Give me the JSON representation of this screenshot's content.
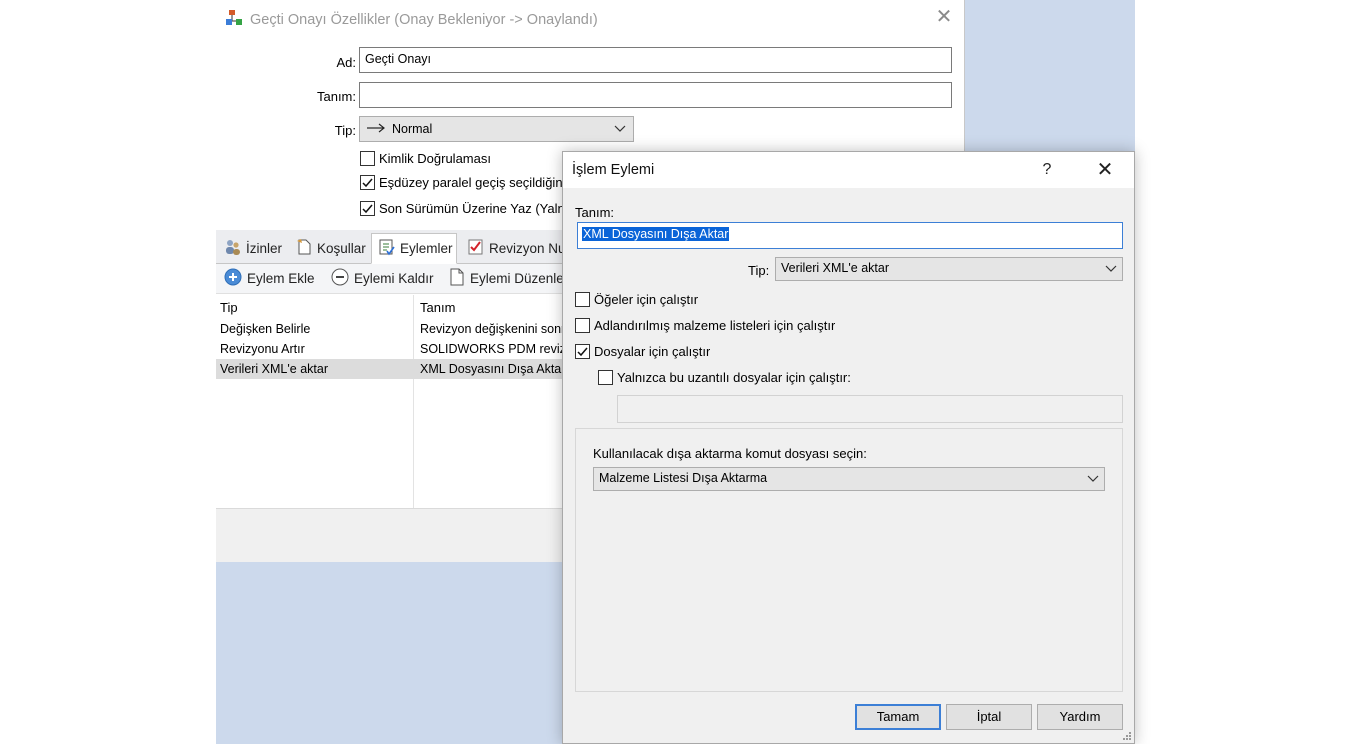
{
  "main_window": {
    "title": "Geçti Onayı Özellikler (Onay Bekleniyor -> Onaylandı)",
    "name_label": "Ad:",
    "name_value": "Geçti Onayı",
    "desc_label": "Tanım:",
    "desc_value": "",
    "type_label": "Tip:",
    "type_value": "Normal",
    "checkboxes": [
      {
        "label": "Kimlik Doğrulaması",
        "checked": false
      },
      {
        "label": "Eşdüzey paralel geçiş seçildiğinde",
        "checked": true
      },
      {
        "label": "Son Sürümün Üzerine Yaz (Yalnızca",
        "checked": true
      }
    ],
    "tabs": [
      {
        "label": "İzinler",
        "icon": "users-icon"
      },
      {
        "label": "Koşullar",
        "icon": "document-hand-icon"
      },
      {
        "label": "Eylemler",
        "icon": "checklist-icon",
        "active": true
      },
      {
        "label": "Revizyon Nu",
        "icon": "red-check-icon"
      }
    ],
    "toolbar": {
      "add": "Eylem Ekle",
      "remove": "Eylemi Kaldır",
      "edit": "Eylemi Düzenle"
    },
    "grid": {
      "headers": [
        "Tip",
        "Tanım"
      ],
      "rows": [
        {
          "type": "Değişken Belirle",
          "desc": "Revizyon değişkenini sonr",
          "selected": false
        },
        {
          "type": "Revizyonu Artır",
          "desc": "SOLIDWORKS PDM revizy",
          "selected": false
        },
        {
          "type": "Verileri XML'e aktar",
          "desc": "XML Dosyasını Dışa Aktar",
          "selected": true
        }
      ]
    }
  },
  "dialog": {
    "title": "İşlem Eylemi",
    "help": "?",
    "desc_label": "Tanım:",
    "desc_value": "XML Dosyasını Dışa Aktar",
    "type_label": "Tip:",
    "type_value": "Verileri XML'e aktar",
    "checks": [
      {
        "label": "Öğeler için çalıştır",
        "checked": false
      },
      {
        "label": "Adlandırılmış malzeme listeleri için çalıştır",
        "checked": false
      },
      {
        "label": "Dosyalar için çalıştır",
        "checked": true
      },
      {
        "label": "Yalnızca bu uzantılı dosyalar için çalıştır:",
        "checked": false
      }
    ],
    "extension_value": "",
    "group_label": "Kullanılacak dışa aktarma komut dosyası seçin:",
    "script_value": "Malzeme Listesi Dışa Aktarma",
    "buttons": {
      "ok": "Tamam",
      "cancel": "İptal",
      "help": "Yardım"
    }
  }
}
